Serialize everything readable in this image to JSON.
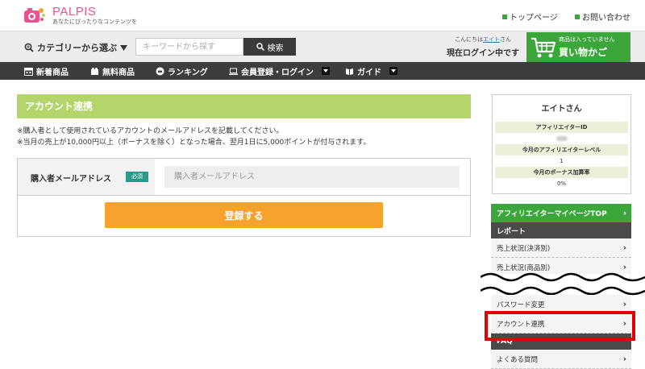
{
  "header": {
    "logo_name": "PALPIS",
    "logo_sub": "あなたにぴったりなコンテンツを",
    "links": [
      "トップページ",
      "お問い合わせ"
    ]
  },
  "search": {
    "category_label": "カテゴリーから選ぶ",
    "placeholder": "キーワードから探す",
    "button": "検索"
  },
  "login": {
    "greeting_prefix": "こんにちは",
    "user": "エイト",
    "greeting_suffix": "さん",
    "status": "現在ログイン中です"
  },
  "cart": {
    "note": "商品は入っていません",
    "title": "買い物かご"
  },
  "nav": {
    "items": [
      "新着商品",
      "無料商品",
      "ランキング",
      "会員登録・ログイン",
      "ガイド"
    ]
  },
  "main": {
    "title": "アカウント連携",
    "notes": [
      "※購入者として使用されているアカウントのメールアドレスを記載してください。",
      "※当月の売上が10,000円以上（ボーナスを除く）となった場合、翌月1日に5,000ポイントが付与されます。"
    ],
    "form": {
      "label": "購入者メールアドレス",
      "required": "必須",
      "placeholder": "購入者メールアドレス",
      "submit": "登録する"
    }
  },
  "profile": {
    "name": "エイトさん",
    "rows": [
      {
        "label": "アフィリエイターID",
        "value": ""
      },
      {
        "label": "今月のアフィリエイターレベル",
        "value": "1"
      },
      {
        "label": "今月のボーナス加算率",
        "value": "0%"
      }
    ]
  },
  "sidebar": {
    "top": "アフィリエイターマイページTOP",
    "report_head": "レポート",
    "report_items": [
      "売上状況(決済別)",
      "売上状況(商品別)"
    ],
    "lower_items": [
      "パスワード変更",
      "アカウント連携"
    ],
    "faq_head": "FAQ",
    "faq_items": [
      "よくある質問"
    ]
  },
  "colors": {
    "brand_green": "#3ca63c",
    "title_green": "#b3d56b",
    "submit_orange": "#f6a22e",
    "required_teal": "#2a9a8a",
    "highlight_red": "#e00000",
    "nav_dark": "#3d3d3d"
  }
}
